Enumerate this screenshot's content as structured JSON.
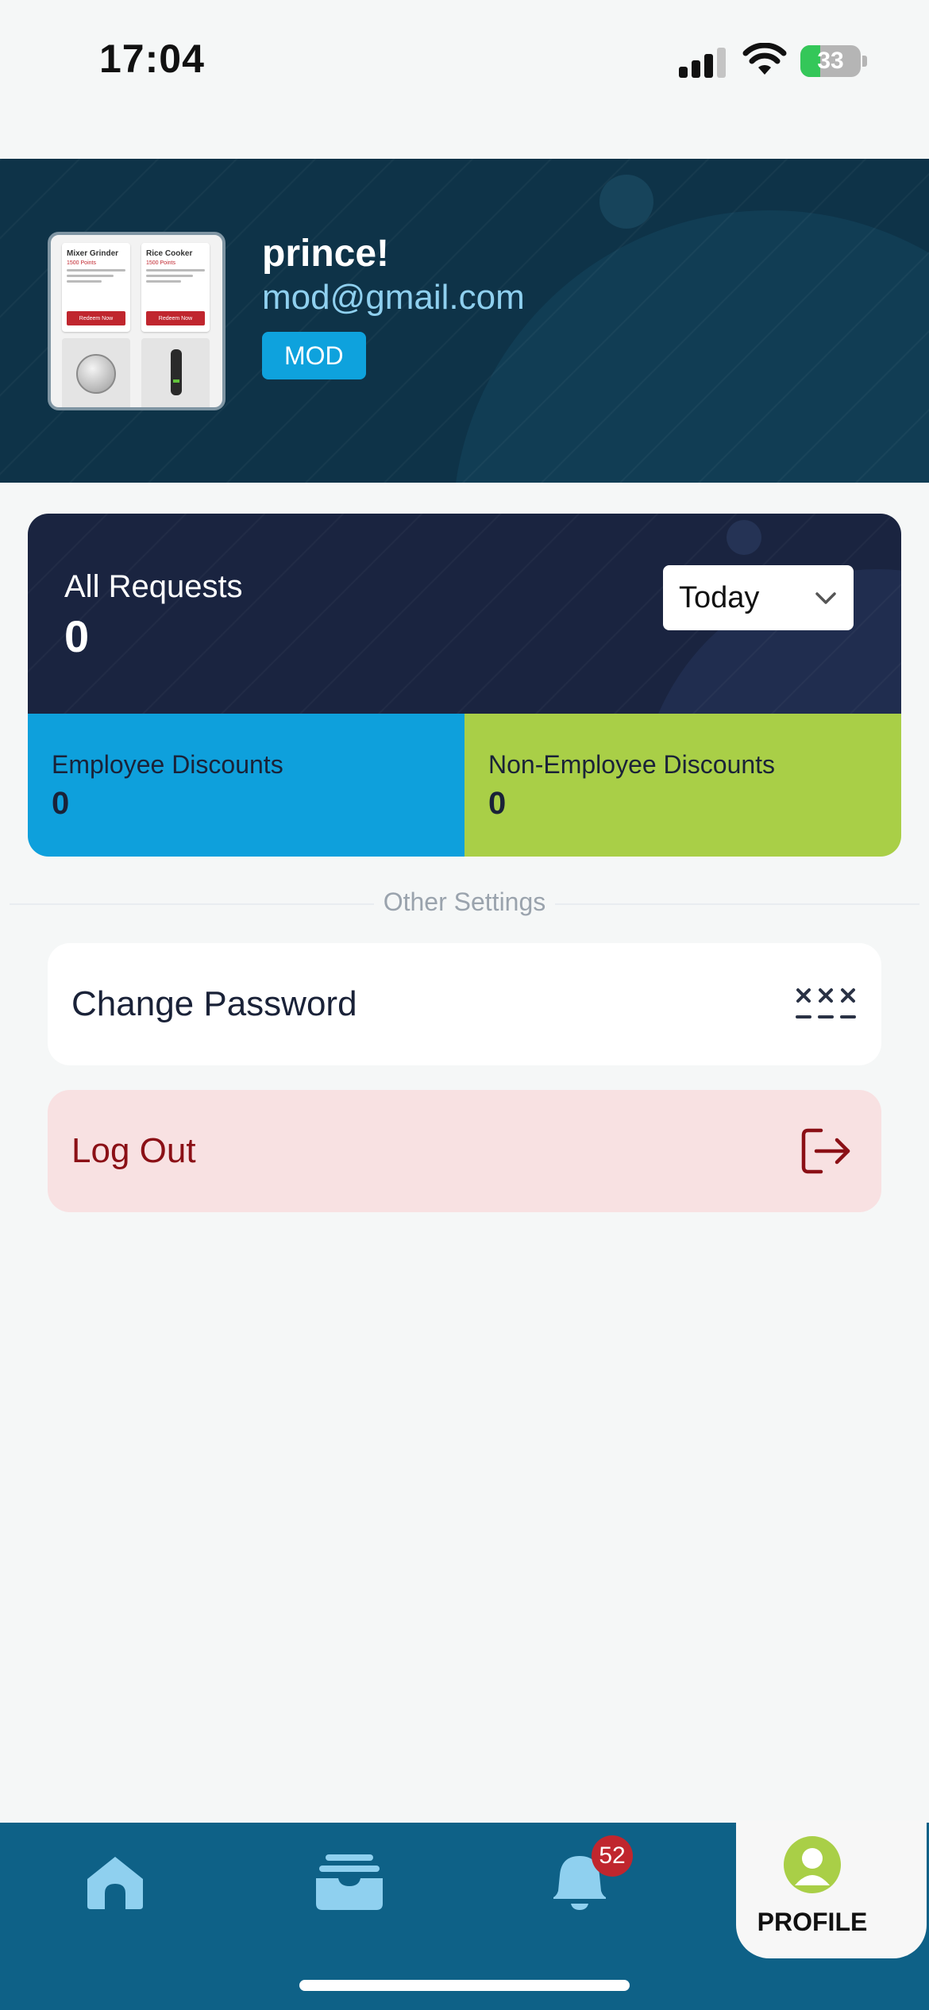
{
  "status_bar": {
    "time": "17:04",
    "battery": "33"
  },
  "profile": {
    "name": "prince!",
    "email": "mod@gmail.com",
    "role": "MOD",
    "avatar_cards": [
      {
        "title": "Mixer Grinder",
        "points": "1500 Points",
        "button": "Redeem Now"
      },
      {
        "title": "Rice Cooker",
        "points": "1500 Points",
        "button": "Redeem Now"
      }
    ]
  },
  "stats": {
    "all_requests_label": "All Requests",
    "all_requests_value": "0",
    "period": "Today",
    "employee_label": "Employee Discounts",
    "employee_value": "0",
    "non_employee_label": "Non-Employee Discounts",
    "non_employee_value": "0"
  },
  "settings": {
    "section_title": "Other Settings",
    "change_password": "Change Password",
    "logout": "Log Out"
  },
  "nav": {
    "notifications_count": "52",
    "profile_label": "PROFILE"
  },
  "colors": {
    "header_bg": "#0e3348",
    "stats_bg": "#1a2440",
    "employee": "#0ea0dc",
    "non_employee": "#a9cf47",
    "nav_bg": "#0e6187",
    "logout_text": "#8b1016"
  }
}
